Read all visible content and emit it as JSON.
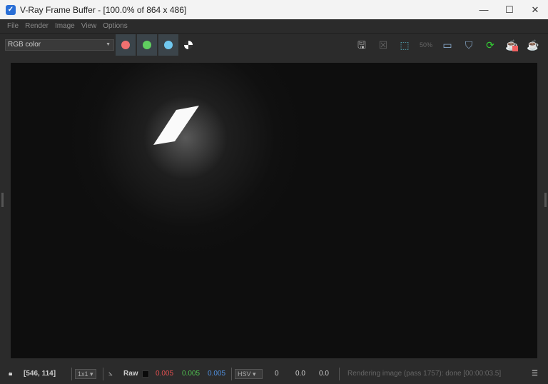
{
  "title": "V-Ray Frame Buffer - [100.0% of 864 x 486]",
  "menu": [
    "File",
    "Render",
    "Image",
    "View",
    "Options"
  ],
  "channel_select": "RGB color",
  "channels": [
    {
      "name": "red",
      "color": "#f07070"
    },
    {
      "name": "green",
      "color": "#60d060"
    },
    {
      "name": "blue",
      "color": "#70c8f0"
    }
  ],
  "status": {
    "coords": "[546, 114]",
    "sample": "1x1",
    "raw_label": "Raw",
    "r": "0.005",
    "g": "0.005",
    "b": "0.005",
    "color_mode": "HSV",
    "h": "0",
    "s": "0.0",
    "v": "0.0",
    "message": "Rendering image (pass 1757): done [00:00:03.5]"
  }
}
